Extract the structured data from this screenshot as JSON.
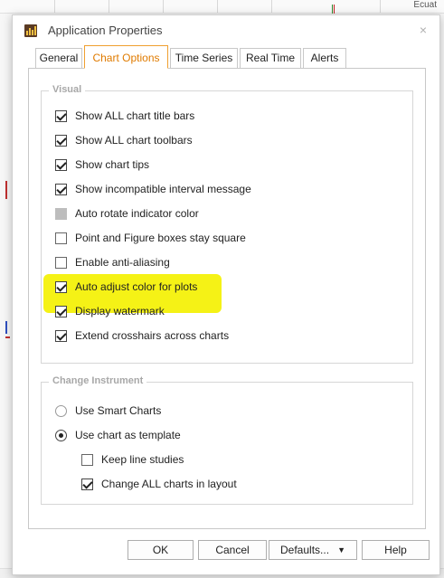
{
  "background": {
    "topright_text": "Ecuat"
  },
  "window": {
    "title": "Application Properties",
    "close_glyph": "×"
  },
  "tabs": [
    {
      "label": "General",
      "active": false
    },
    {
      "label": "Chart Options",
      "active": true
    },
    {
      "label": "Time Series",
      "active": false
    },
    {
      "label": "Real Time",
      "active": false
    },
    {
      "label": "Alerts",
      "active": false
    }
  ],
  "visual_group": {
    "title": "Visual",
    "items": [
      {
        "label": "Show ALL chart title bars",
        "state": "checked"
      },
      {
        "label": "Show ALL chart toolbars",
        "state": "checked"
      },
      {
        "label": "Show chart tips",
        "state": "checked"
      },
      {
        "label": "Show incompatible interval message",
        "state": "checked"
      },
      {
        "label": "Auto rotate indicator color",
        "state": "disabled"
      },
      {
        "label": "Point and Figure boxes stay square",
        "state": "unchecked"
      },
      {
        "label": "Enable anti-aliasing",
        "state": "unchecked"
      },
      {
        "label": "Auto adjust color for plots",
        "state": "checked",
        "highlighted": true
      },
      {
        "label": "Display watermark",
        "state": "checked"
      },
      {
        "label": "Extend crosshairs across charts",
        "state": "checked"
      }
    ]
  },
  "change_instrument_group": {
    "title": "Change Instrument",
    "radios": [
      {
        "label": "Use Smart Charts",
        "selected": false
      },
      {
        "label": "Use chart as template",
        "selected": true
      }
    ],
    "sub_items": [
      {
        "label": "Keep line studies",
        "state": "unchecked"
      },
      {
        "label": "Change ALL charts in layout",
        "state": "checked"
      }
    ]
  },
  "buttons": {
    "ok": "OK",
    "cancel": "Cancel",
    "defaults": "Defaults...",
    "defaults_caret": "▼",
    "help": "Help"
  },
  "colors": {
    "active_tab_text": "#e07b00",
    "active_tab_border": "#f0a030",
    "highlight": "#f5f216",
    "group_title": "#a8a8a8"
  }
}
